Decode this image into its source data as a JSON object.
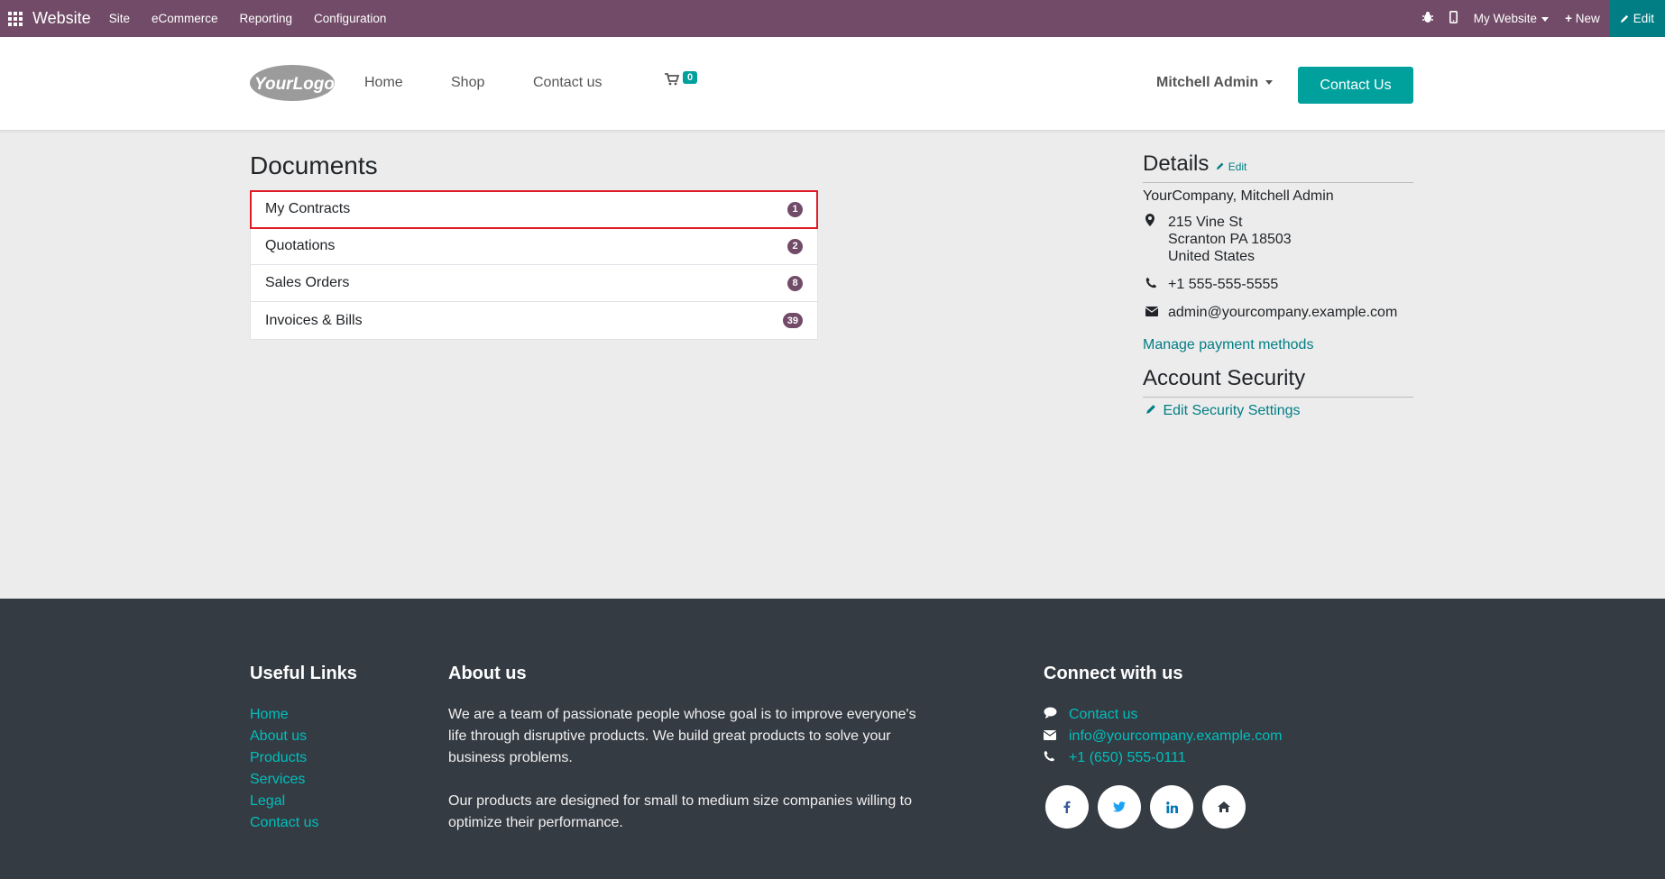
{
  "topbar": {
    "brand": "Website",
    "menus": [
      "Site",
      "eCommerce",
      "Reporting",
      "Configuration"
    ],
    "website_selector": "My Website",
    "new_label": "New",
    "edit_label": "Edit"
  },
  "header": {
    "logo_text": "YourLogo",
    "nav": [
      "Home",
      "Shop",
      "Contact us"
    ],
    "cart_count": "0",
    "user_name": "Mitchell Admin",
    "cta_label": "Contact Us"
  },
  "documents": {
    "title": "Documents",
    "items": [
      {
        "label": "My Contracts",
        "count": "1"
      },
      {
        "label": "Quotations",
        "count": "2"
      },
      {
        "label": "Sales Orders",
        "count": "8"
      },
      {
        "label": "Invoices & Bills",
        "count": "39"
      }
    ]
  },
  "details": {
    "title": "Details",
    "edit_label": "Edit",
    "company": "YourCompany, Mitchell Admin",
    "address": [
      "215 Vine St",
      "Scranton PA 18503",
      "United States"
    ],
    "phone": "+1 555-555-5555",
    "email": "admin@yourcompany.example.com",
    "manage_payment": "Manage payment methods",
    "security_title": "Account Security",
    "security_link": "Edit Security Settings"
  },
  "footer": {
    "useful_links_title": "Useful Links",
    "useful_links": [
      "Home",
      "About us",
      "Products",
      "Services",
      "Legal",
      "Contact us"
    ],
    "about_title": "About us",
    "about_p1": "We are a team of passionate people whose goal is to improve everyone's life through disruptive products. We build great products to solve your business problems.",
    "about_p2": "Our products are designed for small to medium size companies willing to optimize their performance.",
    "connect_title": "Connect with us",
    "connect_contact": "Contact us",
    "connect_email": "info@yourcompany.example.com",
    "connect_phone": "+1 (650) 555-0111"
  },
  "colors": {
    "topbar": "#714b67",
    "accent": "#00a09d",
    "link": "#017e84",
    "footer": "#353b43",
    "highlight": "#e01b24"
  }
}
